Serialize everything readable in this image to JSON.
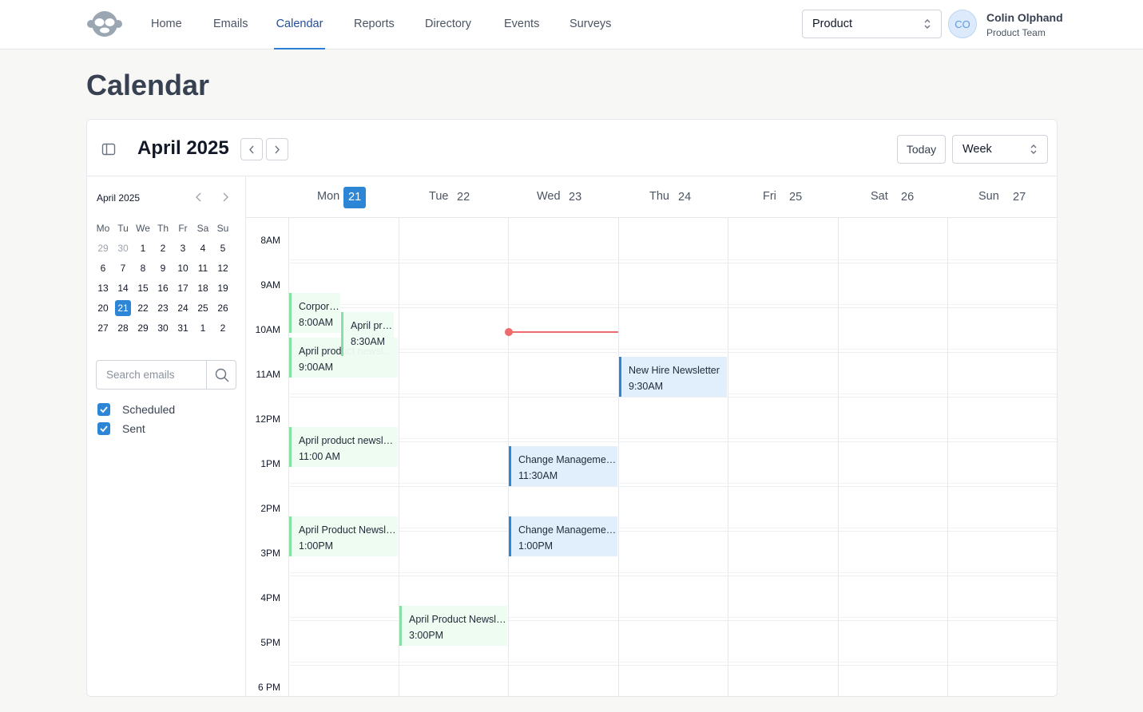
{
  "nav": {
    "items": [
      "Home",
      "Emails",
      "Calendar",
      "Reports",
      "Directory",
      "Events",
      "Surveys"
    ],
    "active": "Calendar"
  },
  "team_select": {
    "value": "Product"
  },
  "user": {
    "initials": "CO",
    "name": "Colin Olphand",
    "team": "Product Team"
  },
  "page": {
    "title": "Calendar"
  },
  "calendar": {
    "month_title": "April 2025",
    "today_label": "Today",
    "view": "Week"
  },
  "mini_calendar": {
    "title": "April 2025",
    "weekdays": [
      "Mo",
      "Tu",
      "We",
      "Th",
      "Fr",
      "Sa",
      "Su"
    ],
    "weeks": [
      [
        "29",
        "30",
        "1",
        "2",
        "3",
        "4",
        "5"
      ],
      [
        "6",
        "7",
        "8",
        "9",
        "10",
        "11",
        "12"
      ],
      [
        "13",
        "14",
        "15",
        "16",
        "17",
        "18",
        "19"
      ],
      [
        "20",
        "21",
        "22",
        "23",
        "24",
        "25",
        "26"
      ],
      [
        "27",
        "28",
        "29",
        "30",
        "31",
        "1",
        "2"
      ]
    ],
    "selected": "21"
  },
  "search": {
    "placeholder": "Search emails",
    "value": ""
  },
  "filters": [
    {
      "label": "Scheduled",
      "checked": true
    },
    {
      "label": "Sent",
      "checked": true
    }
  ],
  "week": {
    "days": [
      {
        "name": "Mon",
        "num": "21",
        "today": true
      },
      {
        "name": "Tue",
        "num": "22"
      },
      {
        "name": "Wed",
        "num": "23"
      },
      {
        "name": "Thu",
        "num": "24"
      },
      {
        "name": "Fri",
        "num": "25"
      },
      {
        "name": "Sat",
        "num": "26"
      },
      {
        "name": "Sun",
        "num": "27"
      }
    ],
    "hours": [
      "8AM",
      "9AM",
      "10AM",
      "11AM",
      "12PM",
      "1PM",
      "2PM",
      "3PM",
      "4PM",
      "5PM",
      "6 PM"
    ]
  },
  "events": [
    {
      "title": "Corporate Newsletter",
      "time": "8:00AM",
      "status": "sent"
    },
    {
      "title": "April product newsletter",
      "time": "8:30AM",
      "status": "sent"
    },
    {
      "title": "April product newsletter",
      "time": "9:00AM",
      "status": "sent"
    },
    {
      "title": "April product newsletter",
      "time": "11:00 AM",
      "status": "sent"
    },
    {
      "title": "April Product Newsletter",
      "time": "1:00PM",
      "status": "sent"
    },
    {
      "title": "April Product Newsletter",
      "time": "3:00PM",
      "status": "sent"
    },
    {
      "title": "Change Management Update",
      "time": "11:30AM",
      "status": "scheduled"
    },
    {
      "title": "Change Management Update",
      "time": "1:00PM",
      "status": "scheduled"
    },
    {
      "title": "New Hire Newsletter",
      "time": "9:30AM",
      "status": "scheduled"
    }
  ],
  "colors": {
    "accent": "#2c86d5",
    "sent": "#86e0a3",
    "scheduled": "#2c86d5",
    "now_line": "#ef6a6a"
  }
}
